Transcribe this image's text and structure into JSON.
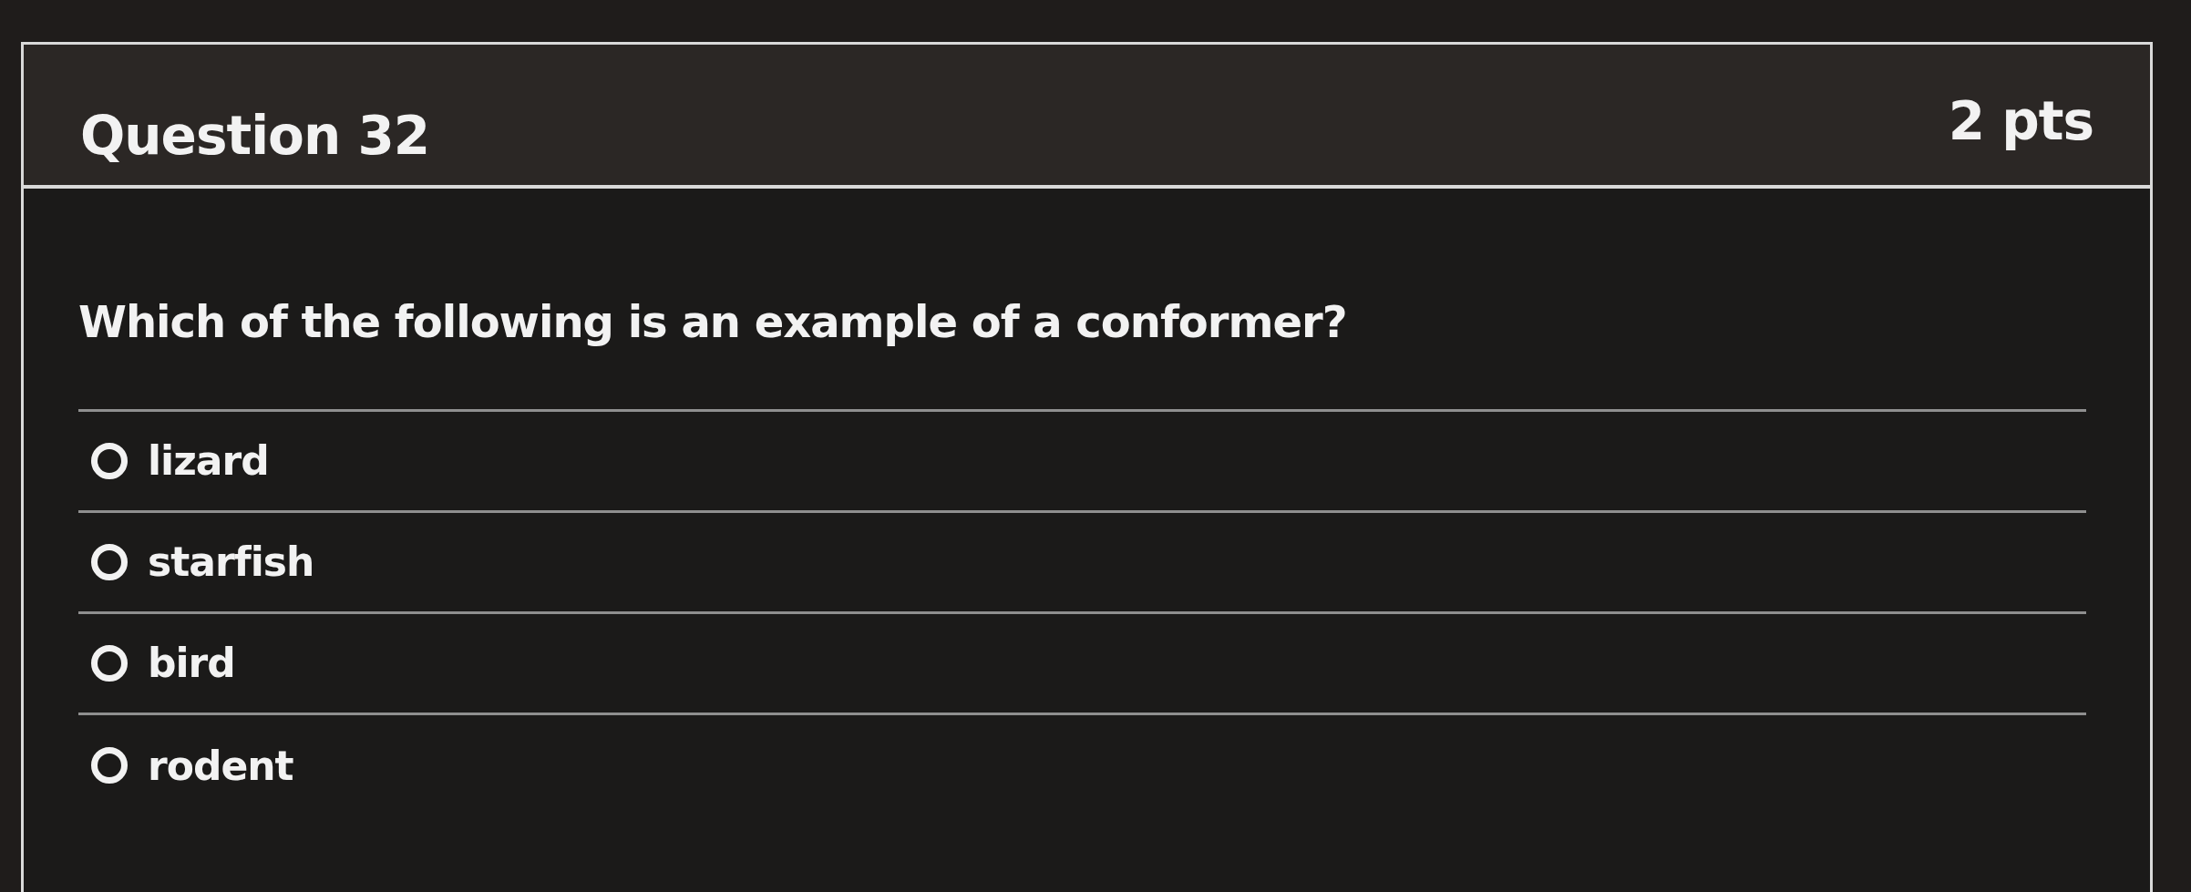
{
  "question": {
    "title": "Question 32",
    "points": "2 pts",
    "prompt": "Which of the following is an example of a conformer?",
    "answers": [
      {
        "label": "lizard",
        "selected": false
      },
      {
        "label": "starfish",
        "selected": false
      },
      {
        "label": "bird",
        "selected": false
      },
      {
        "label": "rodent",
        "selected": false
      }
    ]
  }
}
